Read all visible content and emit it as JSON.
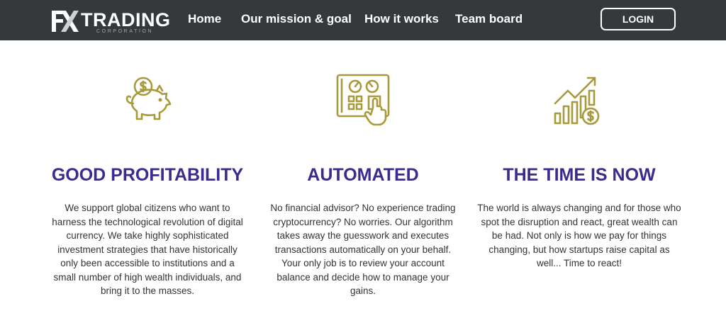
{
  "brand": {
    "logo_mark": "FX",
    "name": "TRADING",
    "tagline": "CORPORATION"
  },
  "nav": {
    "items": [
      {
        "label": "Home"
      },
      {
        "label": "Our mission & goal"
      },
      {
        "label": "How it works"
      },
      {
        "label": "Team board"
      }
    ],
    "login_label": "LOGIN"
  },
  "features": [
    {
      "icon": "piggy-bank-icon",
      "title": "GOOD PROFITABILITY",
      "text": "We support global citizens who want to harness the technological revolution of digital currency. We take highly sophisticated investment strategies that have historically only been accessible to institutions and a small number of high wealth individuals, and bring it to the masses."
    },
    {
      "icon": "control-panel-icon",
      "title": "AUTOMATED",
      "text": "No financial advisor? No experience trading cryptocurrency? No worries. Our algorithm takes away the guesswork and executes transactions automatically on your behalf. Your only job is to review your account balance and decide how to manage your gains."
    },
    {
      "icon": "growth-chart-icon",
      "title": "THE TIME IS NOW",
      "text": "The world is always changing and for those who spot the disruption and react, great wealth can be had. Not only is how we pay for things changing, but how startups raise capital as well... Time to react!"
    }
  ],
  "colors": {
    "nav_bg": "#36393c",
    "heading": "#3a2b8c",
    "icon_gold": "#a89a3a",
    "body_text": "#333333"
  }
}
